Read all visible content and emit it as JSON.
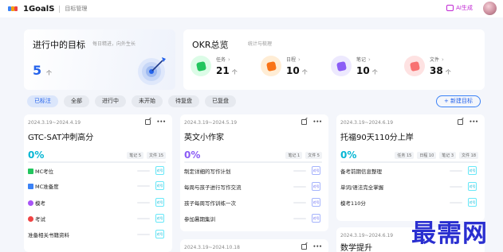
{
  "header": {
    "app_name": "1GoalS",
    "breadcrumb": "目标管理",
    "ai_label": "AI生成"
  },
  "goal_summary": {
    "title": "进行中的目标",
    "subtitle": "每日精进，向外生长",
    "count": "5",
    "unit": "个"
  },
  "okr_summary": {
    "title": "OKR总览",
    "subtitle": "统计与梳理",
    "stats": [
      {
        "label": "任务",
        "value": "21",
        "unit": "个",
        "color": "#22c55e"
      },
      {
        "label": "日程",
        "value": "10",
        "unit": "个",
        "color": "#f97316"
      },
      {
        "label": "笔记",
        "value": "10",
        "unit": "个",
        "color": "#8b5cf6"
      },
      {
        "label": "文件",
        "value": "38",
        "unit": "个",
        "color": "#ef4444"
      }
    ]
  },
  "filters": [
    "已标注",
    "全部",
    "进行中",
    "未开始",
    "待复盘",
    "已复盘"
  ],
  "new_goal_label": "+ 新建目标",
  "more_label": "•••",
  "goals": [
    {
      "date": "2024.3.19~2024.4.19",
      "title": "GTC-SAT冲刺高分",
      "progress": "0%",
      "meta": [
        "笔记 5",
        "文件 15"
      ],
      "tasks": [
        {
          "name": "MC考位",
          "icon_color": "#22c55e",
          "cb": "对号"
        },
        {
          "name": "MC准备度",
          "icon_color": "#3b82f6",
          "cb": "对号"
        },
        {
          "name": "模考",
          "icon_color": "#a855f7",
          "cb": "对号"
        },
        {
          "name": "考试",
          "icon_color": "#ef4444",
          "cb": "对号"
        },
        {
          "name": "准备相关书籍资料",
          "icon_color": "",
          "cb": "对号"
        }
      ]
    },
    {
      "date": "2024.3.19~2024.5.19",
      "title": "英文小作家",
      "progress": "0%",
      "meta": [
        "笔记 1",
        "文件 5"
      ],
      "tasks": [
        {
          "name": "制定详细的写作计划",
          "icon_color": "",
          "cb": "对号"
        },
        {
          "name": "每周与孩子进行写作交流",
          "icon_color": "",
          "cb": "对号"
        },
        {
          "name": "孩子每周写作训练一次",
          "icon_color": "",
          "cb": "对号"
        },
        {
          "name": "参加暑期集训",
          "icon_color": "",
          "cb": "对号"
        }
      ]
    },
    {
      "date": "2024.3.19~2024.6.19",
      "title": "托福90天110分上岸",
      "progress": "0%",
      "meta": [
        "任务 15",
        "日程 10",
        "笔记 3",
        "文件 18"
      ],
      "tasks": [
        {
          "name": "备考前期信息整理",
          "icon_color": "",
          "cb": "对号"
        },
        {
          "name": "单词/语法完全掌握",
          "icon_color": "",
          "cb": "对号"
        },
        {
          "name": "模考110分",
          "icon_color": "",
          "cb": "对号"
        }
      ]
    },
    {
      "date": "2024.3.19~2024.10.18",
      "title": ""
    },
    {
      "date": "2024.3.19~2024.6.19",
      "title": "数学提升"
    }
  ],
  "watermark": "最需网"
}
